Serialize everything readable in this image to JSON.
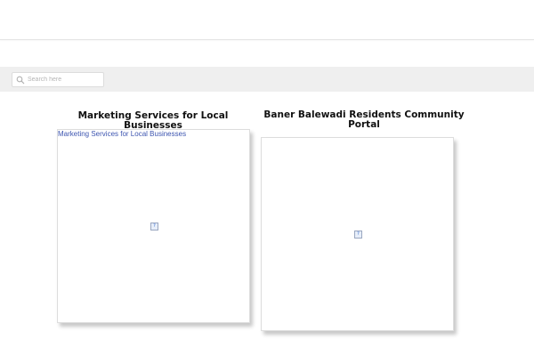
{
  "search": {
    "placeholder": "Search here",
    "icon": "search-icon"
  },
  "cards": [
    {
      "title": "Marketing Services for Local Businesses",
      "link_text": "Marketing Services for Local Businesses",
      "image_icon": "broken-image-icon",
      "image_glyph": "?"
    },
    {
      "title": "Baner Balewadi Residents Community Portal",
      "image_icon": "broken-image-icon",
      "image_glyph": "?"
    }
  ],
  "colors": {
    "link": "#3d55b0",
    "strip": "#efefef",
    "title": "#111111"
  }
}
